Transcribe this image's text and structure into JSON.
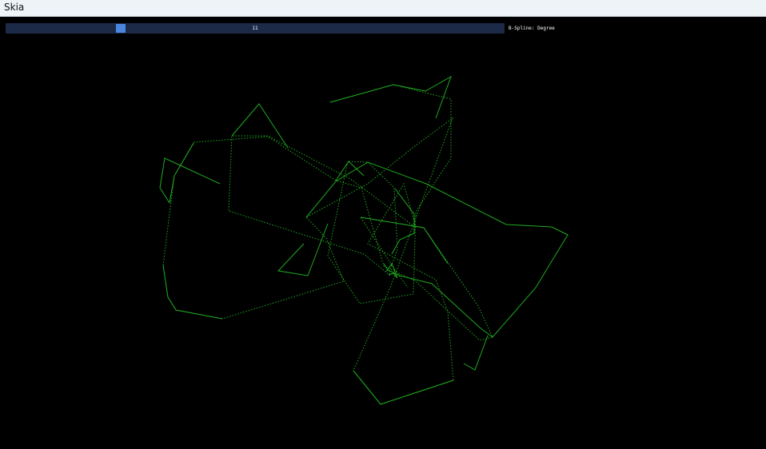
{
  "window": {
    "title": "Skia"
  },
  "slider": {
    "value": "11",
    "label": "B-Spline: Degree",
    "fraction": 0.226
  },
  "colors": {
    "background": "#000000",
    "curve": "#1faa1f",
    "slider_frame": "#1c2a48",
    "slider_grab": "#4a86e0"
  }
}
